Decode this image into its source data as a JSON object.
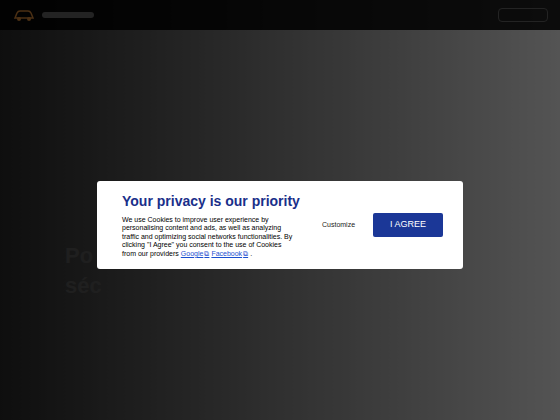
{
  "hero": {
    "title_lines": [
      "Po",
      "séc"
    ]
  },
  "modal": {
    "title": "Your privacy is our priority",
    "body_lines": [
      "We use Cookies to improve user experience by",
      "personalising content and ads, as well as analyzing",
      "traffic and optimizing social networks functionalities. By",
      "clicking \"I Agree\" you consent to the use of Cookies"
    ],
    "last_line_prefix": "from our providers",
    "links": [
      {
        "label": "Google",
        "icon": "⧉"
      },
      {
        "label": "Facebook",
        "icon": "⧉"
      }
    ],
    "last_line_suffix": ".",
    "customize": "Customize",
    "agree": "I AGREE"
  }
}
